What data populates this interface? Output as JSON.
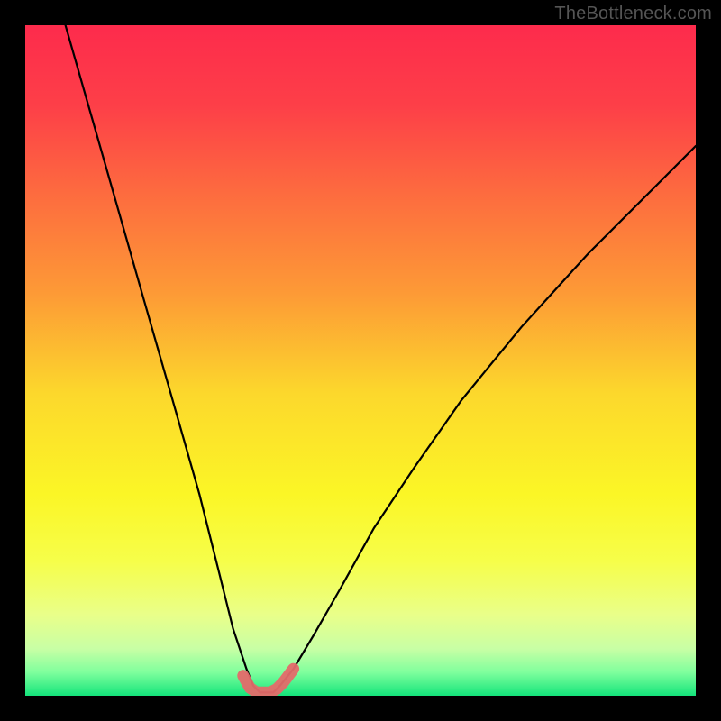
{
  "watermark": {
    "text": "TheBottleneck.com"
  },
  "gradient": {
    "stops": [
      {
        "offset": 0,
        "color": "#fd2b4c"
      },
      {
        "offset": 0.12,
        "color": "#fd3f48"
      },
      {
        "offset": 0.25,
        "color": "#fd6b3f"
      },
      {
        "offset": 0.4,
        "color": "#fd9a36"
      },
      {
        "offset": 0.55,
        "color": "#fcd82c"
      },
      {
        "offset": 0.7,
        "color": "#fbf626"
      },
      {
        "offset": 0.8,
        "color": "#f6fe4a"
      },
      {
        "offset": 0.88,
        "color": "#e9ff8a"
      },
      {
        "offset": 0.93,
        "color": "#c8ffa5"
      },
      {
        "offset": 0.965,
        "color": "#7fff9d"
      },
      {
        "offset": 1.0,
        "color": "#14e47b"
      }
    ]
  },
  "curve": {
    "stroke": "#000000",
    "width": 2.2,
    "overlay_stroke": "#e46a6a",
    "overlay_width": 13
  },
  "chart_data": {
    "type": "line",
    "title": "",
    "xlabel": "",
    "ylabel": "",
    "xlim": [
      0,
      100
    ],
    "ylim": [
      0,
      100
    ],
    "note": "Bottleneck-style V-curve. x is a hardware-balance parameter (0–100), y is mismatch percentage (0=optimal at bottom green band, 100=worst at top red). Values are read off the plotted black curve; the pink overlay marks the near-zero flat bottom.",
    "series": [
      {
        "name": "bottleneck-curve",
        "x": [
          6,
          10,
          14,
          18,
          22,
          26,
          29,
          31,
          33,
          34,
          35,
          36,
          37,
          38,
          40,
          43,
          47,
          52,
          58,
          65,
          74,
          84,
          94,
          100
        ],
        "y": [
          100,
          86,
          72,
          58,
          44,
          30,
          18,
          10,
          4,
          1.5,
          0.5,
          0.5,
          0.5,
          1.5,
          4,
          9,
          16,
          25,
          34,
          44,
          55,
          66,
          76,
          82
        ]
      },
      {
        "name": "optimal-band",
        "x": [
          32.5,
          33.5,
          34.5,
          35.5,
          36.5,
          37.5,
          38.5,
          40
        ],
        "y": [
          3,
          1.2,
          0.5,
          0.5,
          0.5,
          1,
          2,
          4
        ]
      }
    ]
  }
}
